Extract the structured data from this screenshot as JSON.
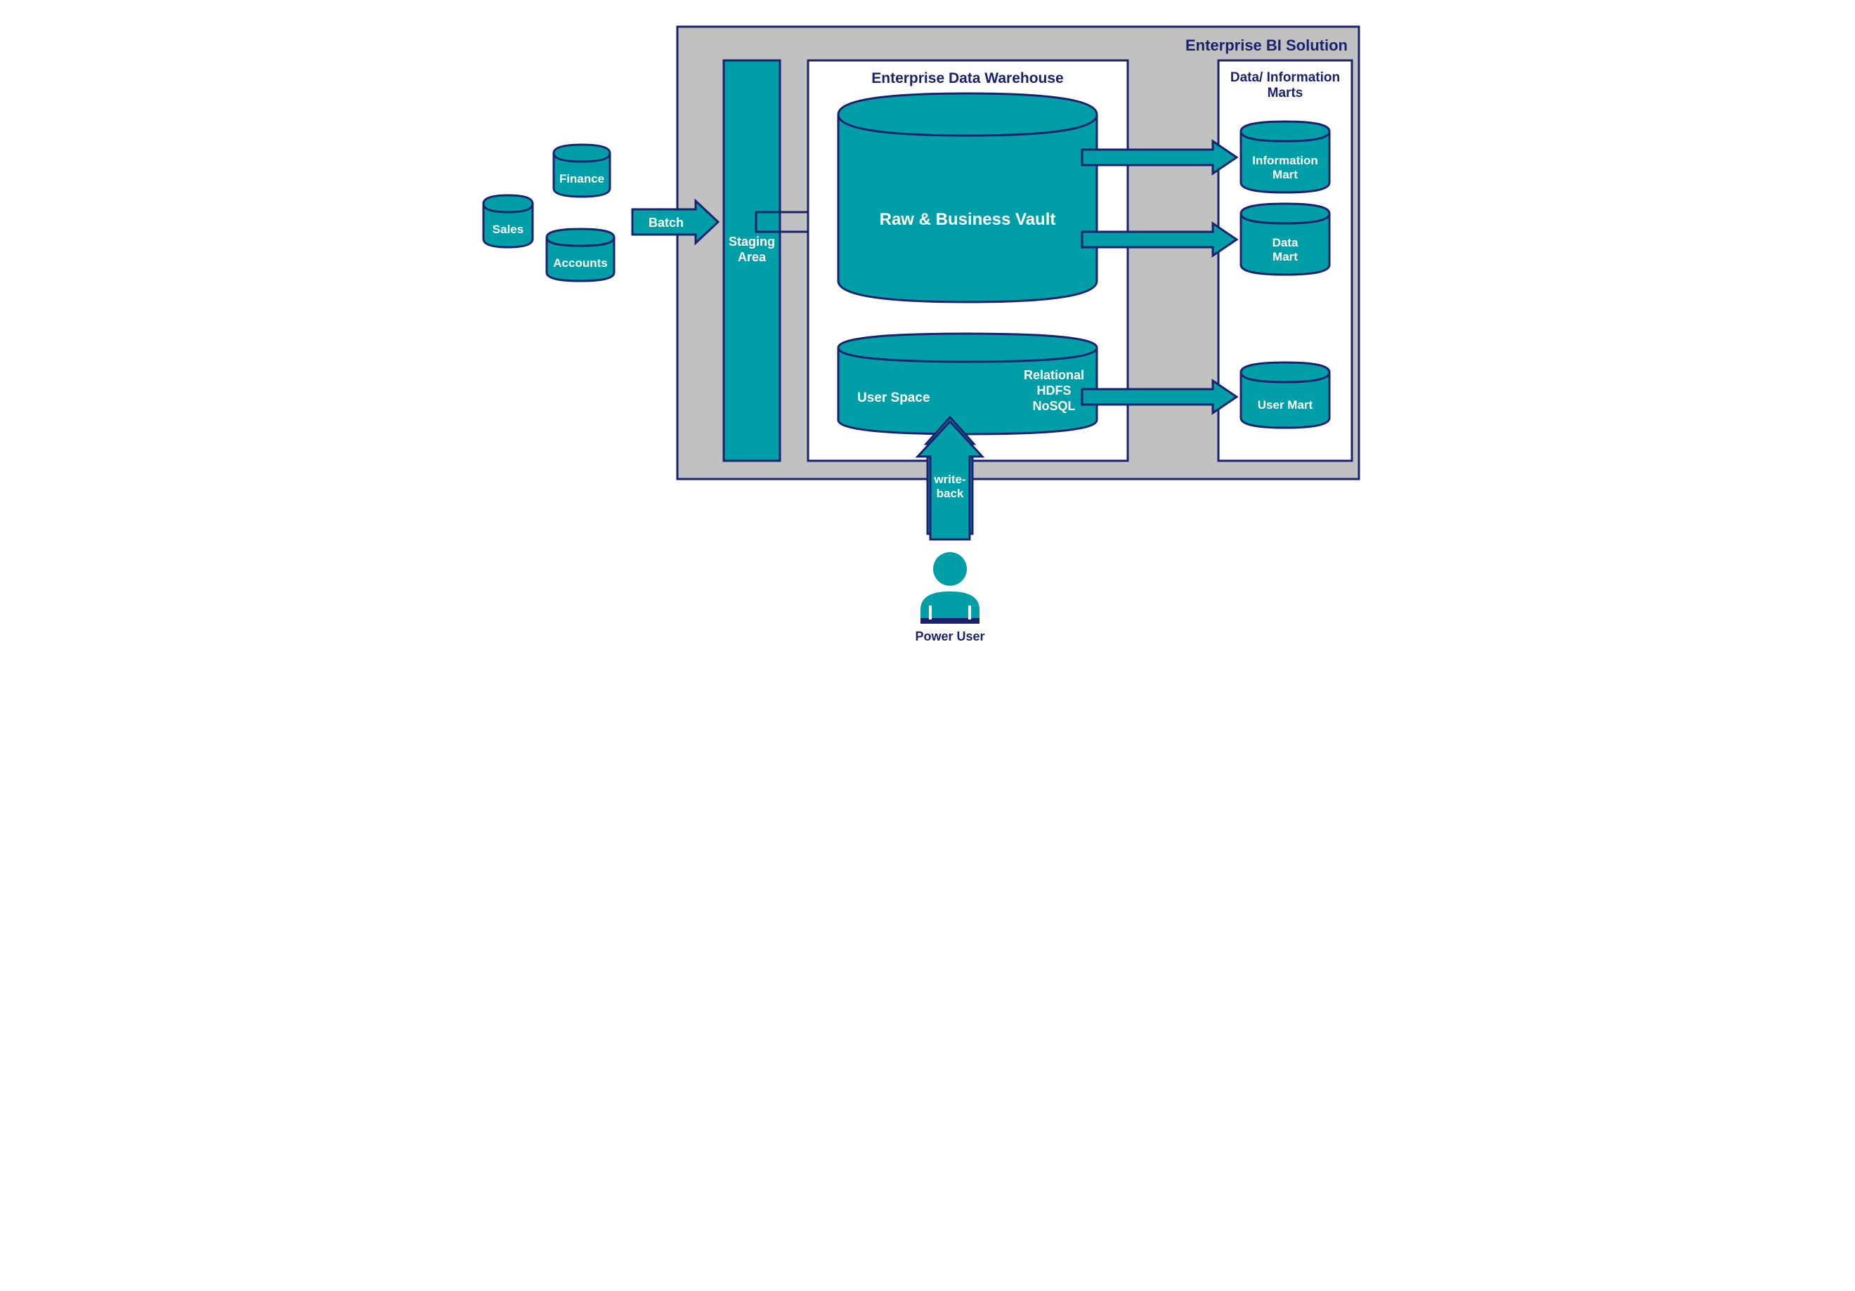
{
  "solution": {
    "title": "Enterprise BI Solution"
  },
  "sources": {
    "sales": "Sales",
    "finance": "Finance",
    "accounts": "Accounts"
  },
  "flow": {
    "batch": "Batch",
    "writeback": "write-\nback"
  },
  "staging": {
    "label": "Staging\nArea"
  },
  "edw": {
    "title": "Enterprise Data Warehouse",
    "vault": "Raw & Business Vault",
    "userspace": {
      "label": "User Space",
      "tech": "Relational\nHDFS\nNoSQL"
    }
  },
  "marts": {
    "title": "Data/ Information\nMarts",
    "info": "Information\nMart",
    "data": "Data\nMart",
    "user": "User Mart"
  },
  "user": {
    "label": "Power User"
  },
  "colors": {
    "teal": "#009fa8",
    "navy": "#1a2270",
    "grey": "#c1c1c1"
  }
}
